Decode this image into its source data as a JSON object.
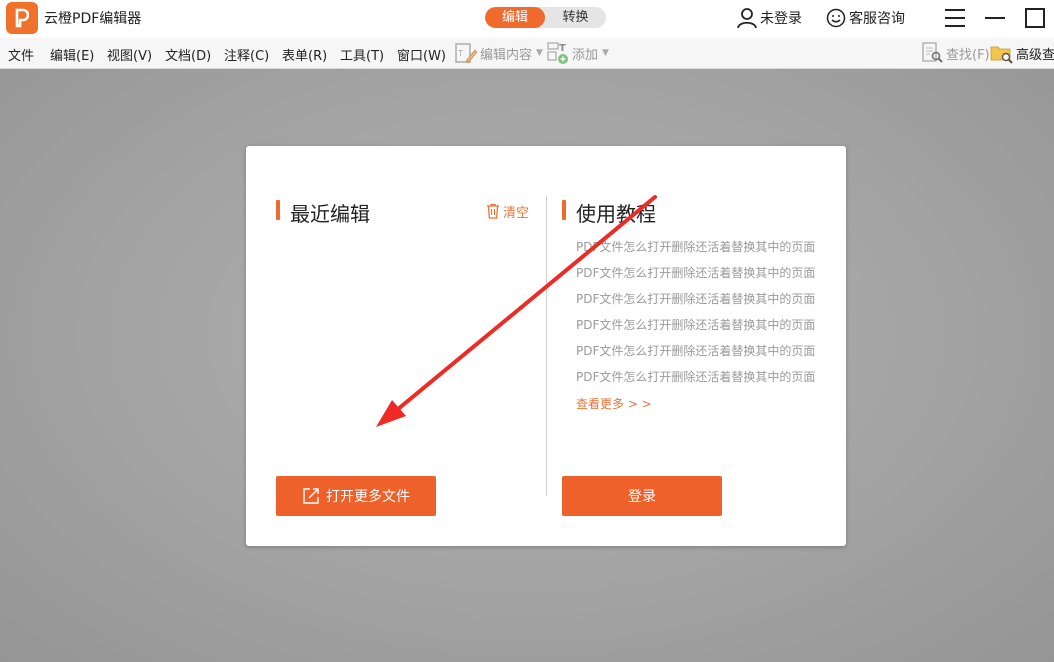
{
  "titlebar": {
    "app_title": "云橙PDF编辑器",
    "mode_edit": "编辑",
    "mode_convert": "转换",
    "user_label": "未登录",
    "service_label": "客服咨询"
  },
  "menubar": {
    "items": [
      "文件",
      "编辑(E)",
      "视图(V)",
      "文档(D)",
      "注释(C)",
      "表单(R)",
      "工具(T)",
      "窗口(W)"
    ],
    "edit_content": "编辑内容",
    "add": "添加",
    "find": "查找(F)",
    "advanced_find": "高级查"
  },
  "recent": {
    "title": "最近编辑",
    "clear": "清空",
    "open_more": "打开更多文件"
  },
  "tutorial": {
    "title": "使用教程",
    "items": [
      "PDF文件怎么打开删除还活着替换其中的页面",
      "PDF文件怎么打开删除还活着替换其中的页面",
      "PDF文件怎么打开删除还活着替换其中的页面",
      "PDF文件怎么打开删除还活着替换其中的页面",
      "PDF文件怎么打开删除还活着替换其中的页面",
      "PDF文件怎么打开删除还活着替换其中的页面"
    ],
    "more": "查看更多 > >",
    "login": "登录"
  },
  "colors": {
    "accent": "#ef612b",
    "annotation_arrow": "#ee2a24"
  }
}
